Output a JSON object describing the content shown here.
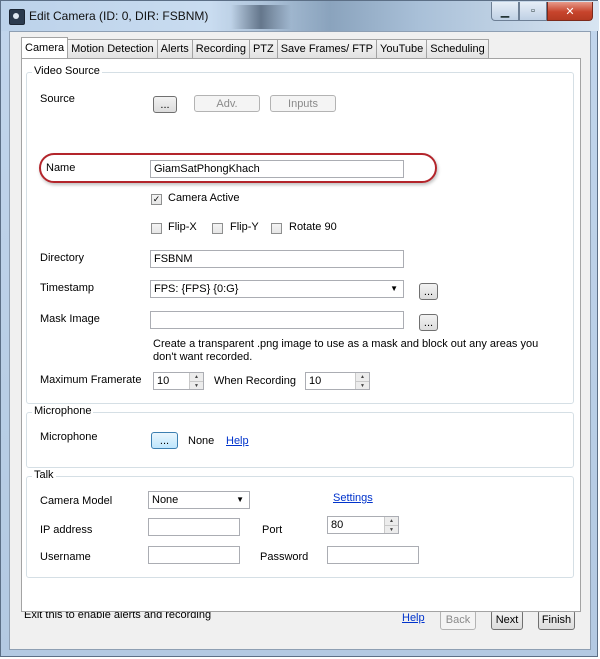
{
  "window": {
    "title": "Edit Camera (ID: 0, DIR: FSBNM)",
    "min_label": "▁",
    "max_label": "▫",
    "close_label": "✕"
  },
  "tabs": [
    {
      "label": "Camera",
      "active": true
    },
    {
      "label": "Motion Detection"
    },
    {
      "label": "Alerts"
    },
    {
      "label": "Recording"
    },
    {
      "label": "PTZ"
    },
    {
      "label": "Save Frames/ FTP"
    },
    {
      "label": "YouTube"
    },
    {
      "label": "Scheduling"
    }
  ],
  "video_source": {
    "legend": "Video Source",
    "source_label": "Source",
    "browse_label": "...",
    "adv_label": "Adv.",
    "inputs_label": "Inputs",
    "name_label": "Name",
    "name_value": "GiamSatPhongKhach",
    "camera_active_label": "Camera Active",
    "camera_active_check": "✓",
    "flip_x_label": "Flip-X",
    "flip_y_label": "Flip-Y",
    "rotate_label": "Rotate 90",
    "directory_label": "Directory",
    "directory_value": "FSBNM",
    "timestamp_label": "Timestamp",
    "timestamp_value": "FPS: {FPS} {0:G}",
    "timestamp_btn": "...",
    "mask_label": "Mask Image",
    "mask_value": "",
    "mask_btn": "...",
    "mask_help": "Create a transparent .png image to use as a mask and block out any areas you don't want recorded.",
    "max_framerate_label": "Maximum Framerate",
    "max_framerate_value": "10",
    "when_recording_label": "When Recording",
    "when_recording_value": "10"
  },
  "microphone": {
    "legend": "Microphone",
    "label": "Microphone",
    "browse_label": "...",
    "value": "None",
    "help_link": "Help"
  },
  "talk": {
    "legend": "Talk",
    "camera_model_label": "Camera Model",
    "camera_model_value": "None",
    "settings_link": "Settings",
    "ip_label": "IP address",
    "ip_value": "",
    "port_label": "Port",
    "port_value": "80",
    "username_label": "Username",
    "username_value": "",
    "password_label": "Password",
    "password_value": ""
  },
  "footer": {
    "status_text": "Exit this to enable alerts and recording",
    "help_link": "Help",
    "back_label": "Back",
    "next_label": "Next",
    "finish_label": "Finish"
  }
}
